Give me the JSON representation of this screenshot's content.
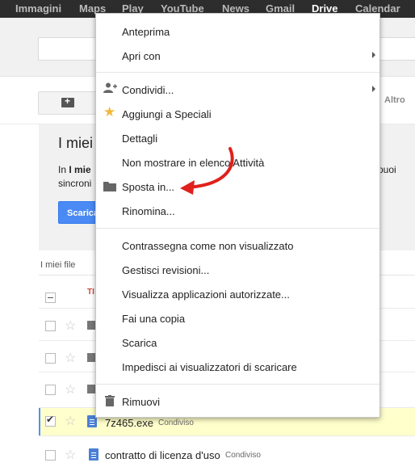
{
  "topnav": {
    "items": [
      "Immagini",
      "Maps",
      "Play",
      "YouTube",
      "News",
      "Gmail",
      "Drive",
      "Calendar"
    ],
    "active": "Drive"
  },
  "toolbar": {
    "altro_label": "Altro"
  },
  "promo": {
    "title": "I miei",
    "line1_prefix": "In ",
    "line1_bold": "I mie",
    "line2": "sincroni",
    "right1": "puoi",
    "button_label": "Scarica"
  },
  "list": {
    "section_label": "I miei file",
    "header_fragment": "TI",
    "files": [
      {
        "name": "7z465.exe",
        "status": "Condiviso"
      },
      {
        "name": "contratto di licenza d'uso",
        "status": "Condiviso"
      }
    ]
  },
  "context_menu": {
    "items": [
      {
        "label": "Anteprima",
        "icon": "",
        "submenu": false
      },
      {
        "label": "Apri con",
        "icon": "",
        "submenu": true
      },
      {
        "label": "Condividi...",
        "icon": "add-person-icon",
        "submenu": true
      },
      {
        "label": "Aggiungi a Speciali",
        "icon": "star-icon",
        "submenu": false
      },
      {
        "label": "Dettagli",
        "icon": "",
        "submenu": false
      },
      {
        "label": "Non mostrare in elenco Attività",
        "icon": "",
        "submenu": false
      },
      {
        "label": "Sposta in...",
        "icon": "folder-icon",
        "submenu": false
      },
      {
        "label": "Rinomina...",
        "icon": "",
        "submenu": false
      },
      {
        "label": "Contrassegna come non visualizzato",
        "icon": "",
        "submenu": false
      },
      {
        "label": "Gestisci revisioni...",
        "icon": "",
        "submenu": false
      },
      {
        "label": "Visualizza applicazioni autorizzate...",
        "icon": "",
        "submenu": false
      },
      {
        "label": "Fai una copia",
        "icon": "",
        "submenu": false
      },
      {
        "label": "Scarica",
        "icon": "",
        "submenu": false
      },
      {
        "label": "Impedisci ai visualizzatori di scaricare",
        "icon": "",
        "submenu": false
      },
      {
        "label": "Rimuovi",
        "icon": "trash-icon",
        "submenu": false
      }
    ]
  },
  "colors": {
    "topbar_bg": "#2d2d2d",
    "accent_blue": "#4a8af4",
    "selected_row_bg": "#ffffcc",
    "annotation_arrow": "#e0201b",
    "star_gold": "#f1b83c"
  }
}
